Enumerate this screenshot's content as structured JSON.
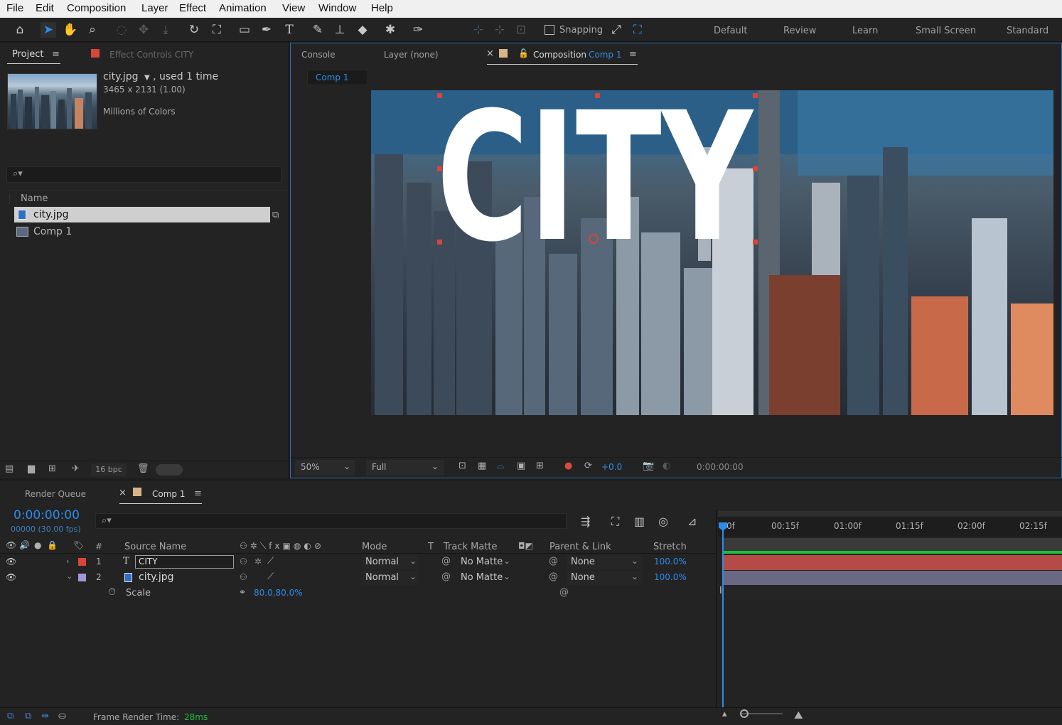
{
  "menu": [
    "File",
    "Edit",
    "Composition",
    "Layer",
    "Effect",
    "Animation",
    "View",
    "Window",
    "Help"
  ],
  "toolbar": {
    "snapping": "Snapping",
    "workspaces": [
      "Default",
      "Review",
      "Learn",
      "Small Screen",
      "Standard"
    ]
  },
  "project": {
    "tab": "Project",
    "effect_controls": "Effect Controls CITY",
    "file_name": "city.jpg",
    "used": ", used 1 time",
    "dimensions": "3465 x 2131 (1.00)",
    "colors": "Millions of Colors",
    "col_name": "Name",
    "items": [
      {
        "name": "city.jpg",
        "selected": true
      },
      {
        "name": "Comp 1",
        "selected": false
      }
    ],
    "bpc": "16 bpc"
  },
  "viewer": {
    "tabs": {
      "console": "Console",
      "layer": "Layer (none)",
      "composition": "Composition",
      "comp_name": "Comp 1"
    },
    "subtab": "Comp 1",
    "overlay_text": "CITY",
    "zoom": "50%",
    "resolution": "Full",
    "exposure": "+0.0",
    "timecode": "0:00:00:00"
  },
  "timeline": {
    "render_queue": "Render Queue",
    "comp_tab": "Comp 1",
    "timecode": "0:00:00:00",
    "frames": "00000 (30.00 fps)",
    "ruler": [
      "0f",
      "00:15f",
      "01:00f",
      "01:15f",
      "02:00f",
      "02:15f"
    ],
    "headers": {
      "num": "#",
      "source": "Source Name",
      "mode": "Mode",
      "t": "T",
      "track_matte": "Track Matte",
      "parent": "Parent & Link",
      "stretch": "Stretch"
    },
    "layers": [
      {
        "num": "1",
        "type": "T",
        "name": "CITY",
        "mode": "Normal",
        "matte": "No Matte",
        "parent": "None",
        "stretch": "100.0%",
        "color": "#d8453a"
      },
      {
        "num": "2",
        "type": "img",
        "name": "city.jpg",
        "mode": "Normal",
        "matte": "No Matte",
        "parent": "None",
        "stretch": "100.0%",
        "color": "#9f97d6"
      }
    ],
    "scale_label": "Scale",
    "scale_value": "80.0,80.0%",
    "frame_render_label": "Frame Render Time:",
    "frame_render_value": "28ms"
  },
  "colors": {
    "accent": "#2d8ceb",
    "layer1_bar": "#b44b46",
    "layer2_bar": "#6b6883",
    "work_area": "#1bc13b"
  }
}
